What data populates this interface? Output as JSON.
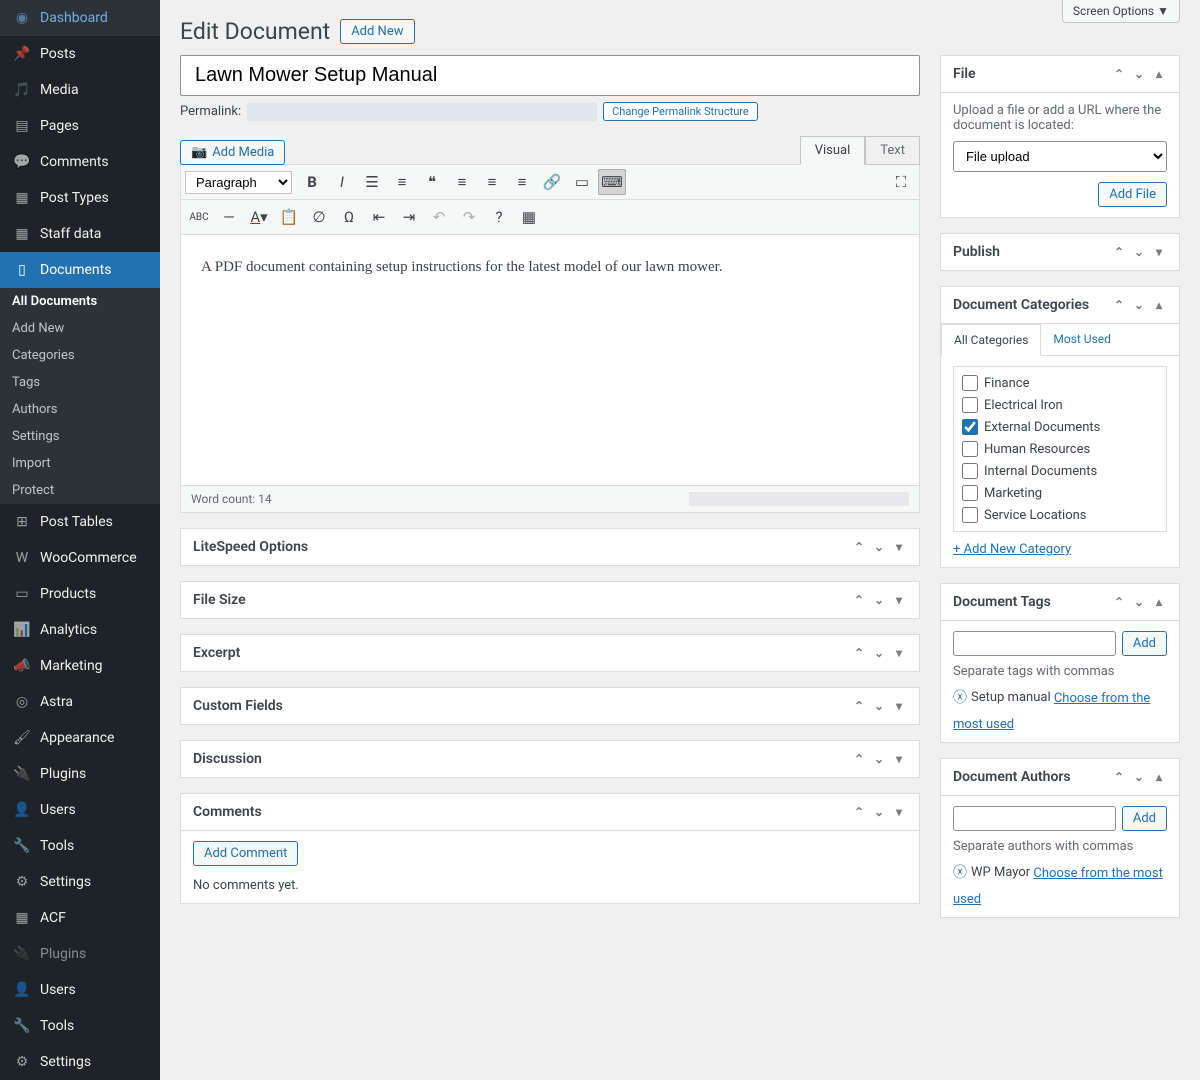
{
  "screen_options_label": "Screen Options",
  "page_title": "Edit Document",
  "add_new_label": "Add New",
  "document_title": "Lawn Mower Setup Manual",
  "permalink_label": "Permalink:",
  "change_permalink_btn": "Change Permalink Structure",
  "add_media_label": "Add Media",
  "editor_tabs": {
    "visual": "Visual",
    "text": "Text"
  },
  "format_select": "Paragraph",
  "editor_content": "A PDF document containing setup instructions for the latest model of our lawn mower.",
  "word_count_label": "Word count: 14",
  "sidebar": {
    "items": [
      {
        "label": "Dashboard"
      },
      {
        "label": "Posts"
      },
      {
        "label": "Media"
      },
      {
        "label": "Pages"
      },
      {
        "label": "Comments"
      },
      {
        "label": "Post Types"
      },
      {
        "label": "Staff data"
      },
      {
        "label": "Documents"
      },
      {
        "label": "Post Tables"
      },
      {
        "label": "WooCommerce"
      },
      {
        "label": "Products"
      },
      {
        "label": "Analytics"
      },
      {
        "label": "Marketing"
      },
      {
        "label": "Astra"
      },
      {
        "label": "Appearance"
      },
      {
        "label": "Plugins"
      },
      {
        "label": "Users"
      },
      {
        "label": "Tools"
      },
      {
        "label": "Settings"
      },
      {
        "label": "ACF"
      },
      {
        "label": "Plugins"
      },
      {
        "label": "Users"
      },
      {
        "label": "Tools"
      },
      {
        "label": "Settings"
      }
    ],
    "submenu": [
      "All Documents",
      "Add New",
      "Categories",
      "Tags",
      "Authors",
      "Settings",
      "Import",
      "Protect"
    ]
  },
  "metaboxes_left": [
    "LiteSpeed Options",
    "File Size",
    "Excerpt",
    "Custom Fields",
    "Discussion",
    "Comments"
  ],
  "add_comment_btn": "Add Comment",
  "no_comments_text": "No comments yet.",
  "file_box": {
    "title": "File",
    "description": "Upload a file or add a URL where the document is located:",
    "select_value": "File upload",
    "add_file_btn": "Add File"
  },
  "publish_box_title": "Publish",
  "categories_box": {
    "title": "Document Categories",
    "tab_all": "All Categories",
    "tab_most": "Most Used",
    "items": [
      {
        "label": "Finance",
        "checked": false
      },
      {
        "label": "Electrical Iron",
        "checked": false
      },
      {
        "label": "External Documents",
        "checked": true
      },
      {
        "label": "Human Resources",
        "checked": false
      },
      {
        "label": "Internal Documents",
        "checked": false
      },
      {
        "label": "Marketing",
        "checked": false
      },
      {
        "label": "Service Locations",
        "checked": false
      }
    ],
    "add_new": "+ Add New Category"
  },
  "tags_box": {
    "title": "Document Tags",
    "add_btn": "Add",
    "help": "Separate tags with commas",
    "existing_tag": "Setup manual",
    "choose_link": "Choose from the most used"
  },
  "authors_box": {
    "title": "Document Authors",
    "add_btn": "Add",
    "help": "Separate authors with commas",
    "existing_author": "WP Mayor",
    "choose_link": "Choose from the most used"
  }
}
